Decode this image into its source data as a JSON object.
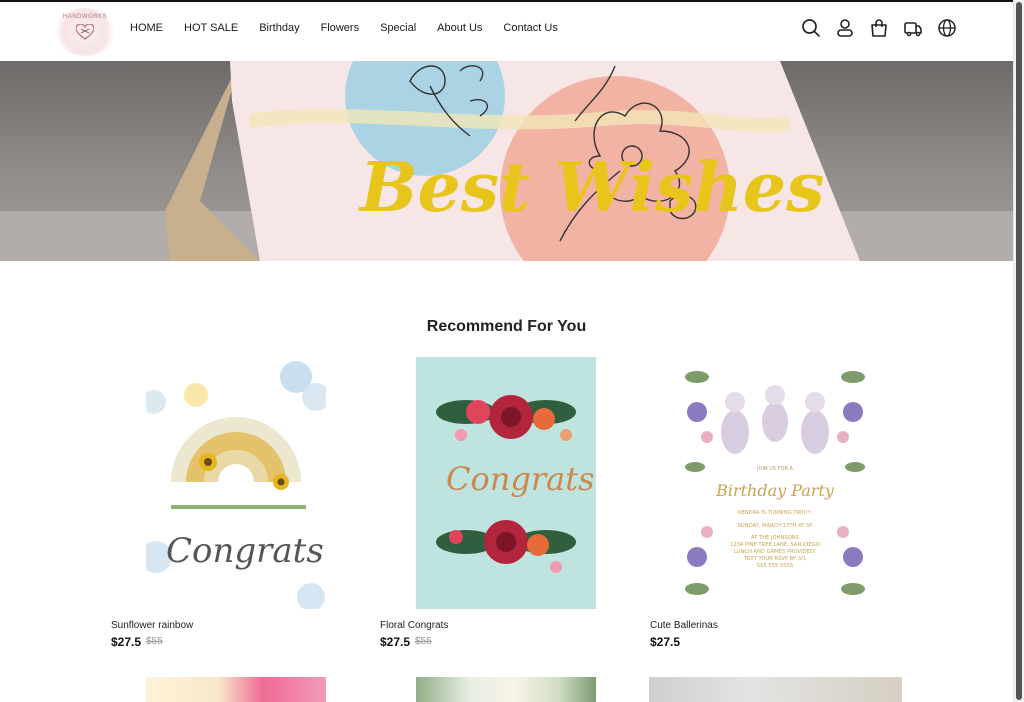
{
  "brand": {
    "logo_text": "HANDWORKS"
  },
  "nav": {
    "items": [
      {
        "label": "HOME"
      },
      {
        "label": "HOT SALE"
      },
      {
        "label": "Birthday"
      },
      {
        "label": "Flowers"
      },
      {
        "label": "Special"
      },
      {
        "label": "About Us"
      },
      {
        "label": "Contact Us"
      }
    ]
  },
  "header_icons": [
    "search-icon",
    "user-icon",
    "cart-icon",
    "shipping-icon",
    "globe-icon"
  ],
  "hero": {
    "card_text": "Best Wishes"
  },
  "recommend": {
    "title": "Recommend For You",
    "products": [
      {
        "name": "Sunflower rainbow",
        "price": "$27.5",
        "old_price": "$55",
        "card_text": "Congrats"
      },
      {
        "name": "Floral Congrats",
        "price": "$27.5",
        "old_price": "$55",
        "card_text": "Congrats"
      },
      {
        "name": "Cute Ballerinas",
        "price": "$27.5",
        "old_price": "",
        "card_text": "Birthday Party",
        "card_lines": [
          "JOIN US FOR A",
          "KENDRA IS TURNING TWO!!!",
          "SUNDAY, MARCH 17TH AT 3P",
          "AT THE JOHNSONS",
          "1234 PINE TREE LANE, SAN DIEGO",
          "LUNCH AND GAMES PROVIDED!",
          "TEXT YOUR RSVP BY 3/1",
          "555 555 5555"
        ]
      }
    ]
  },
  "colors": {
    "accent": "#1a1a1a",
    "price": "#111111",
    "old_price": "#999999",
    "hero_gold": "#e8c51b"
  }
}
